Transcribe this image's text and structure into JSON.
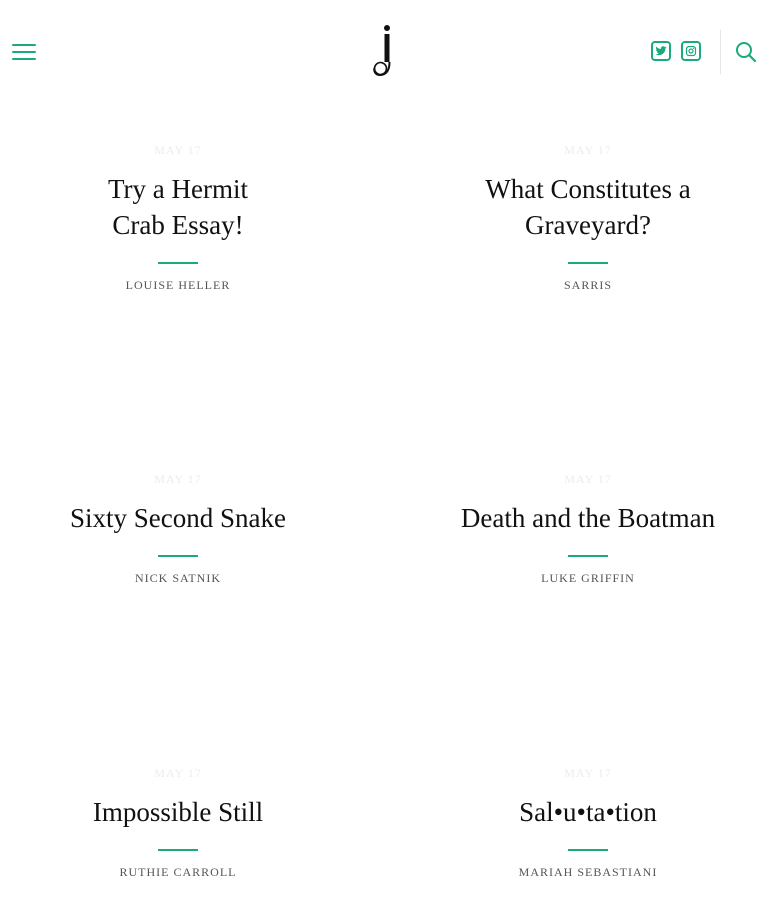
{
  "header": {
    "menu_icon": "hamburger-menu-icon",
    "logo_letter": "j",
    "social": [
      {
        "name": "twitter",
        "icon": "twitter-icon"
      },
      {
        "name": "instagram",
        "icon": "instagram-icon"
      }
    ],
    "search_icon": "search-icon",
    "accent_color": "#1aaa7e"
  },
  "articles": [
    {
      "date": "MAY 17",
      "title": "Try a Hermit Crab Essay!",
      "author": "LOUISE HELLER"
    },
    {
      "date": "MAY 17",
      "title": "What Constitutes a Graveyard?",
      "author": "SARRIS"
    },
    {
      "date": "MAY 17",
      "title": "Sixty Second Snake",
      "author": "NICK SATNIK"
    },
    {
      "date": "MAY 17",
      "title": "Death and the Boatman",
      "author": "LUKE GRIFFIN"
    },
    {
      "date": "MAY 17",
      "title": "Impossible Still",
      "author": "RUTHIE CARROLL"
    },
    {
      "date": "MAY 17",
      "title": "Sal•u•ta•tion",
      "author": "MARIAH SEBASTIANI"
    }
  ]
}
